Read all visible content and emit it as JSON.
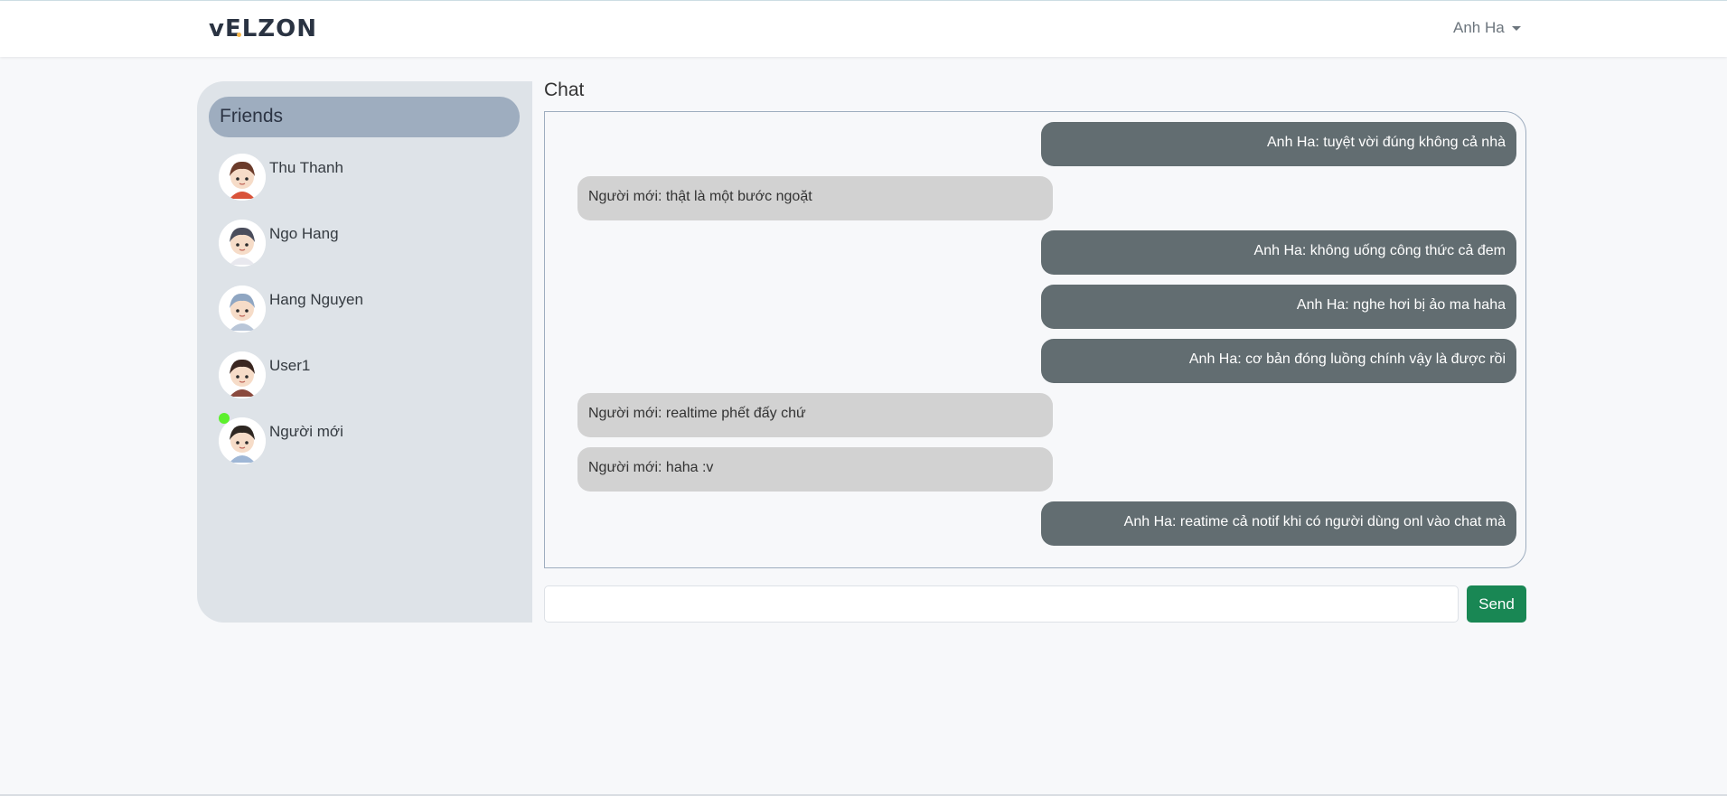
{
  "navbar": {
    "logo_first": "v",
    "logo_rest": "ELZON",
    "user_name": "Anh Ha"
  },
  "sidebar": {
    "title": "Friends",
    "friends": [
      {
        "name": "Thu Thanh",
        "online": false,
        "hair": "#6b3b2a",
        "shirt": "#d9533a"
      },
      {
        "name": "Ngo Hang",
        "online": false,
        "hair": "#4a4d5c",
        "shirt": "#e8e8ee"
      },
      {
        "name": "Hang Nguyen",
        "online": false,
        "hair": "#8fa6c2",
        "shirt": "#b9c6d8"
      },
      {
        "name": "User1",
        "online": false,
        "hair": "#3a2620",
        "shirt": "#8a4a3e"
      },
      {
        "name": "Người mới",
        "online": true,
        "hair": "#2e2722",
        "shirt": "#9fb7d6"
      }
    ]
  },
  "chat": {
    "title": "Chat",
    "messages": [
      {
        "from": "me",
        "text": "Anh Ha: tuyệt vời đúng không cả nhà"
      },
      {
        "from": "them",
        "text": "Người mới: thật là một bước ngoặt"
      },
      {
        "from": "me",
        "text": "Anh Ha: không uống công thức cả đem"
      },
      {
        "from": "me",
        "text": "Anh Ha: nghe hơi bị ảo ma haha"
      },
      {
        "from": "me",
        "text": "Anh Ha: cơ bản đóng luồng chính vậy là được rồi"
      },
      {
        "from": "them",
        "text": "Người mới: realtime phết đấy chứ"
      },
      {
        "from": "them",
        "text": "Người mới: haha :v"
      },
      {
        "from": "me",
        "text": "Anh Ha: reatime cả notif khi có người dùng onl vào chat mà"
      }
    ],
    "input_value": "",
    "send_label": "Send"
  },
  "colors": {
    "accent_send": "#198754",
    "my_bubble": "#626d71",
    "their_bubble": "#d2d2d2",
    "online": "#5cf02c"
  }
}
